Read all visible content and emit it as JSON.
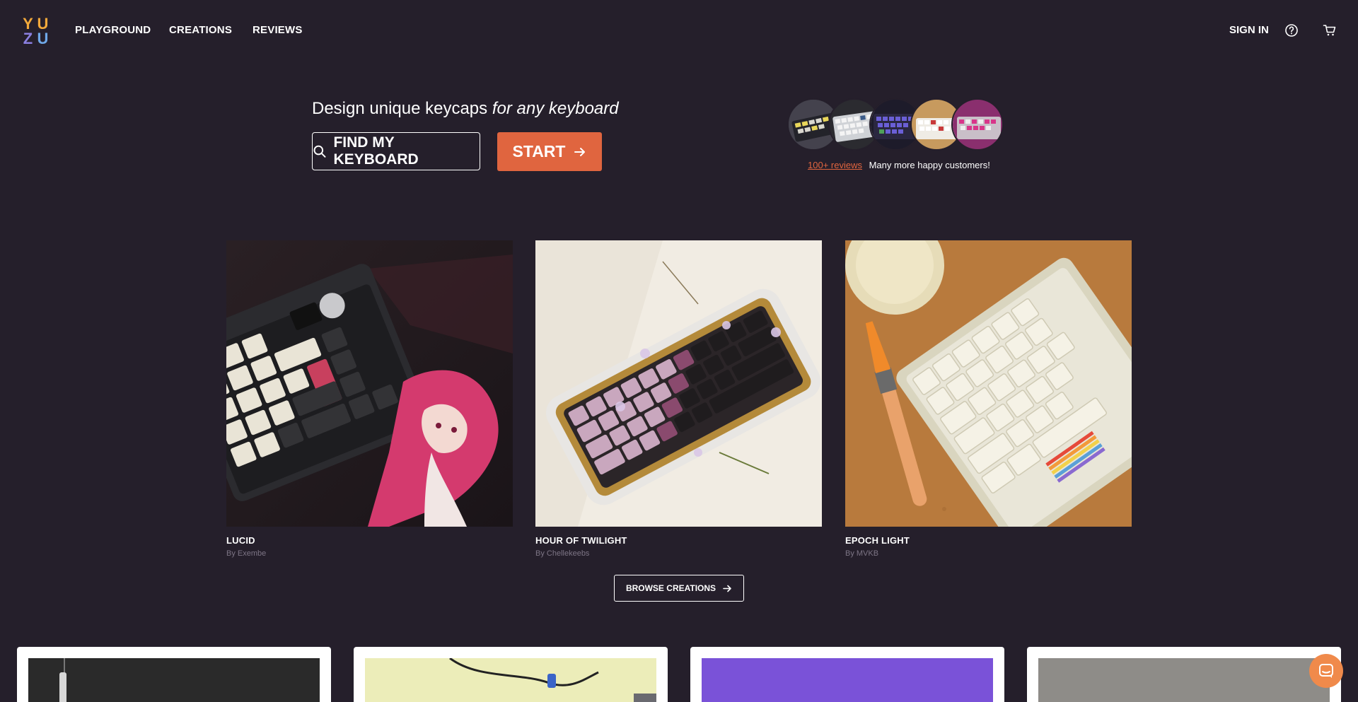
{
  "header": {
    "logo_letters": [
      "Y",
      "U",
      "Z",
      "U"
    ],
    "nav": [
      "PLAYGROUND",
      "CREATIONS",
      "REVIEWS"
    ],
    "sign_in": "SIGN IN",
    "icons": [
      "help-icon",
      "cart-icon"
    ]
  },
  "hero": {
    "title_main": "Design unique keycaps ",
    "title_em": "for any keyboard",
    "find_button": "FIND MY KEYBOARD",
    "start_button": "START",
    "reviews_link": "100+ reviews",
    "reviews_text": "Many more happy customers!"
  },
  "creations": [
    {
      "title": "LUCID",
      "author": "By Exembe"
    },
    {
      "title": "HOUR OF TWILIGHT",
      "author": "By Chellekeebs"
    },
    {
      "title": "EPOCH LIGHT",
      "author": "By MVKB"
    }
  ],
  "browse_button": "BROWSE CREATIONS",
  "colors": {
    "background": "#251f2b",
    "accent": "#e0653f",
    "chat": "#f08a4b"
  }
}
